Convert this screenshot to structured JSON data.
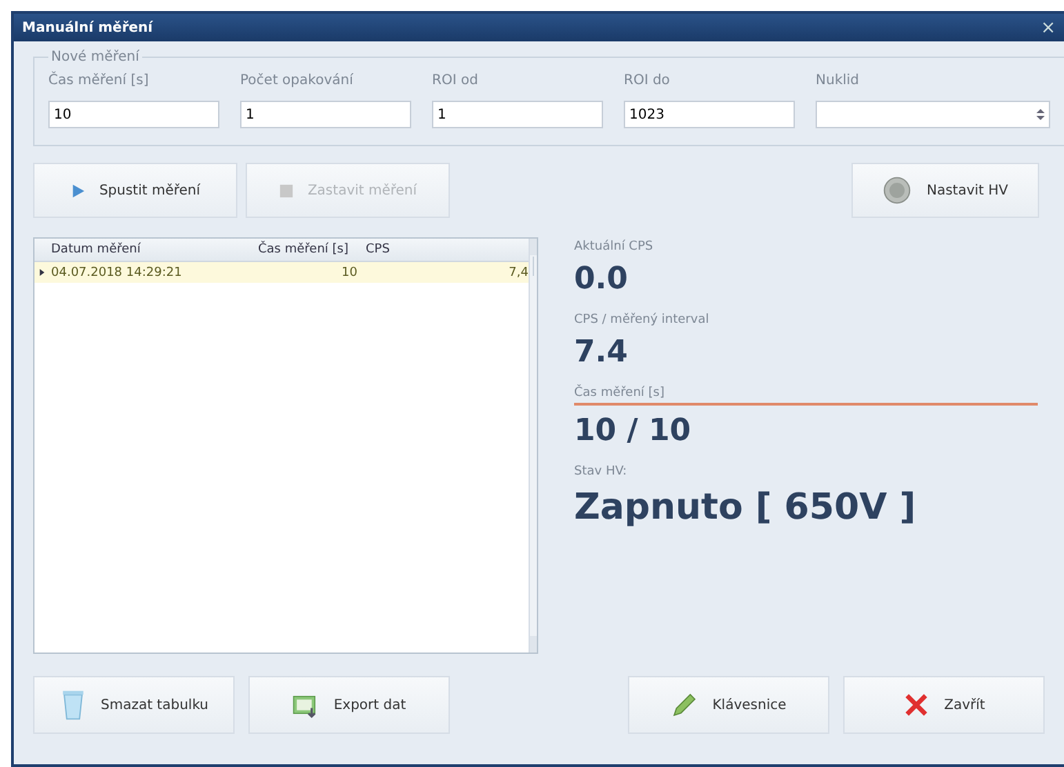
{
  "window": {
    "title": "Manuální měření",
    "close": "×"
  },
  "group": {
    "title": "Nové měření",
    "fields": [
      {
        "label": "Čas měření [s]",
        "value": "10",
        "kind": "text"
      },
      {
        "label": "Počet opakování",
        "value": "1",
        "kind": "text"
      },
      {
        "label": "ROI od",
        "value": "1",
        "kind": "text"
      },
      {
        "label": "ROI do",
        "value": "1023",
        "kind": "text"
      },
      {
        "label": "Nuklid",
        "kind": "combo"
      }
    ]
  },
  "actions": [
    {
      "label": "Spustit měření",
      "kind": "play",
      "disabled": false
    },
    {
      "label": "Zastavit měření",
      "kind": "stop",
      "disabled": true
    }
  ],
  "hv_button": {
    "label": "Nastavit HV"
  },
  "table": {
    "columns": [
      "Datum měření",
      "Čas měření [s]",
      "CPS"
    ],
    "rows": [
      {
        "cells": [
          "04.07.2018 14:29:21",
          "10",
          "7,4"
        ],
        "selected": true
      }
    ]
  },
  "stats": [
    {
      "label": "Aktuální CPS",
      "value": "0.0",
      "kind": "plain"
    },
    {
      "label": "CPS / měřený interval",
      "value": "7.4",
      "kind": "plain"
    },
    {
      "label": "Čas měření [s]",
      "value": "10 / 10",
      "kind": "progress",
      "level": 1
    },
    {
      "label": "Stav HV:",
      "value": "Zapnuto [ 650V ]",
      "kind": "large"
    }
  ],
  "bottom_buttons": [
    {
      "label": "Smazat tabulku",
      "kind": "trash"
    },
    {
      "label": "Export dat",
      "kind": "export"
    },
    {
      "label": "Klávesnice",
      "kind": "pencil"
    },
    {
      "label": "Zavřít",
      "kind": "cross"
    }
  ]
}
